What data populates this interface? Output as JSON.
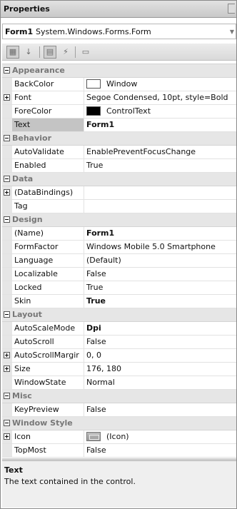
{
  "window": {
    "title": "Properties"
  },
  "object_selector": {
    "name": "Form1",
    "type": "System.Windows.Forms.Form"
  },
  "toolbar": [
    {
      "icon": "categorized-icon",
      "glyph": "▦",
      "active": true
    },
    {
      "icon": "alphabetical-icon",
      "glyph": "↓",
      "active": false
    },
    {
      "icon": "properties-icon",
      "glyph": "▤",
      "active": true
    },
    {
      "icon": "events-icon",
      "glyph": "⚡",
      "active": false
    },
    {
      "icon": "property-pages-icon",
      "glyph": "▭",
      "active": false
    }
  ],
  "rows": [
    {
      "kind": "cat",
      "label": "Appearance"
    },
    {
      "kind": "prop",
      "name": "BackColor",
      "value": "Window",
      "swatch": "white"
    },
    {
      "kind": "prop",
      "name": "Font",
      "value": "Segoe Condensed, 10pt, style=Bold",
      "expand": true
    },
    {
      "kind": "prop",
      "name": "ForeColor",
      "value": "ControlText",
      "swatch": "black"
    },
    {
      "kind": "prop",
      "name": "Text",
      "value": "Form1",
      "bold": true,
      "selected": true
    },
    {
      "kind": "cat",
      "label": "Behavior"
    },
    {
      "kind": "prop",
      "name": "AutoValidate",
      "value": "EnablePreventFocusChange"
    },
    {
      "kind": "prop",
      "name": "Enabled",
      "value": "True"
    },
    {
      "kind": "cat",
      "label": "Data"
    },
    {
      "kind": "prop",
      "name": "(DataBindings)",
      "value": "",
      "expand": true
    },
    {
      "kind": "prop",
      "name": "Tag",
      "value": ""
    },
    {
      "kind": "cat",
      "label": "Design"
    },
    {
      "kind": "prop",
      "name": "(Name)",
      "value": "Form1",
      "bold": true
    },
    {
      "kind": "prop",
      "name": "FormFactor",
      "value": "Windows Mobile 5.0 Smartphone"
    },
    {
      "kind": "prop",
      "name": "Language",
      "value": "(Default)"
    },
    {
      "kind": "prop",
      "name": "Localizable",
      "value": "False"
    },
    {
      "kind": "prop",
      "name": "Locked",
      "value": "True"
    },
    {
      "kind": "prop",
      "name": "Skin",
      "value": "True",
      "bold": true
    },
    {
      "kind": "cat",
      "label": "Layout"
    },
    {
      "kind": "prop",
      "name": "AutoScaleMode",
      "value": "Dpi",
      "bold": true
    },
    {
      "kind": "prop",
      "name": "AutoScroll",
      "value": "False"
    },
    {
      "kind": "prop",
      "name": "AutoScrollMargir",
      "value": "0, 0",
      "expand": true
    },
    {
      "kind": "prop",
      "name": "Size",
      "value": "176, 180",
      "expand": true
    },
    {
      "kind": "prop",
      "name": "WindowState",
      "value": "Normal"
    },
    {
      "kind": "cat",
      "label": "Misc"
    },
    {
      "kind": "prop",
      "name": "KeyPreview",
      "value": "False"
    },
    {
      "kind": "cat",
      "label": "Window Style"
    },
    {
      "kind": "prop",
      "name": "Icon",
      "value": "(Icon)",
      "expand": true,
      "icon_preview": true
    },
    {
      "kind": "prop",
      "name": "TopMost",
      "value": "False"
    }
  ],
  "description": {
    "title": "Text",
    "text": "The text contained in the control."
  }
}
